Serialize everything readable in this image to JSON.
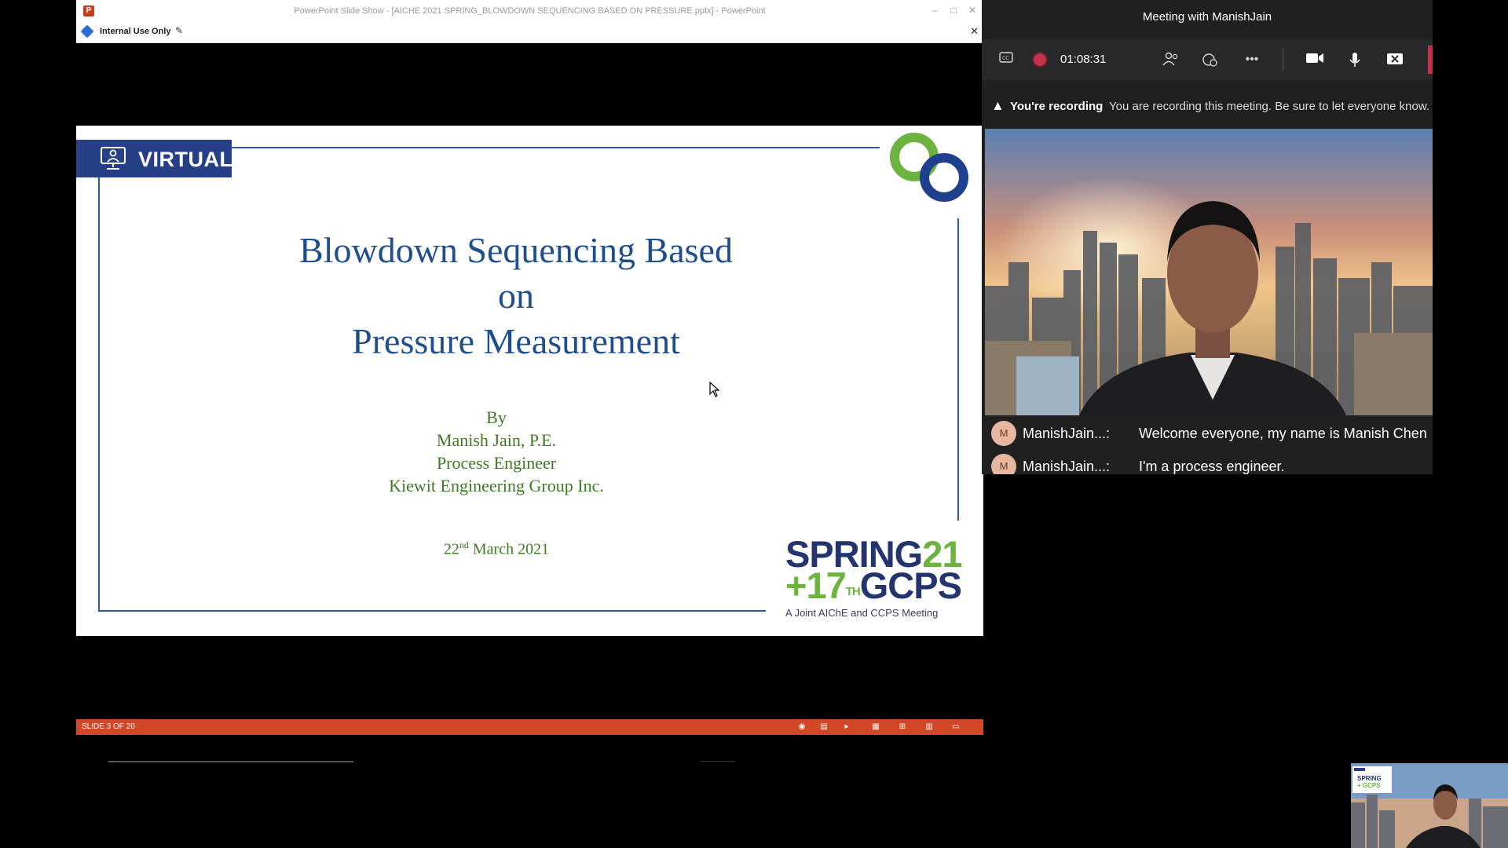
{
  "powerpoint": {
    "window_title": "PowerPoint Slide Show - [AICHE 2021 SPRING_BLOWDOWN SEQUENCING BASED ON PRESSURE.pptx] - PowerPoint",
    "app_icon": "P",
    "minimize": "–",
    "maximize": "□",
    "close": "✕",
    "sensitivity_label": "Internal Use Only",
    "edit_glyph": "✎",
    "infobar_close": "✕",
    "status": {
      "slide_counter": "SLIDE 3 OF 20"
    }
  },
  "slide": {
    "badge": "VIRTUAL",
    "title_lines": [
      "Blowdown Sequencing Based",
      "on",
      "Pressure Measurement"
    ],
    "by": "By",
    "author": "Manish Jain, P.E.",
    "role": "Process Engineer",
    "company": "Kiewit Engineering Group Inc.",
    "date_day": "22",
    "date_suffix": "nd",
    "date_rest": " March 2021",
    "conference": {
      "line1_a": "SPRING",
      "line1_b": "21",
      "line2_a": "+17",
      "line2_sup": "TH",
      "line2_b": "GCPS",
      "subtitle": "A Joint AIChE and CCPS Meeting"
    },
    "colors": {
      "title": "#1f4e8c",
      "body": "#3d7a22",
      "badge_bg": "#273f87",
      "frame": "#2a5aa0",
      "ring_green": "#6db33f",
      "ring_navy": "#1f3f8f"
    }
  },
  "teams": {
    "meeting_title": "Meeting with ManishJain",
    "timer": "01:08:31",
    "toolbar_icons": [
      "captions-icon",
      "record-icon",
      "people-icon",
      "reactions-icon",
      "more-icon",
      "camera-icon",
      "mic-icon",
      "share-icon"
    ],
    "recording_bold": "You're recording",
    "recording_message": "You are recording this meeting. Be sure to let everyone know.",
    "captions": [
      {
        "initial": "M",
        "speaker": "ManishJain...:",
        "text": "Welcome everyone, my name is Manish Chen"
      },
      {
        "initial": "M",
        "speaker": "ManishJain...:",
        "text": "I'm a process engineer."
      }
    ],
    "colors": {
      "panel": "#202020",
      "toolbar": "#292929",
      "record": "#c4314b"
    }
  }
}
